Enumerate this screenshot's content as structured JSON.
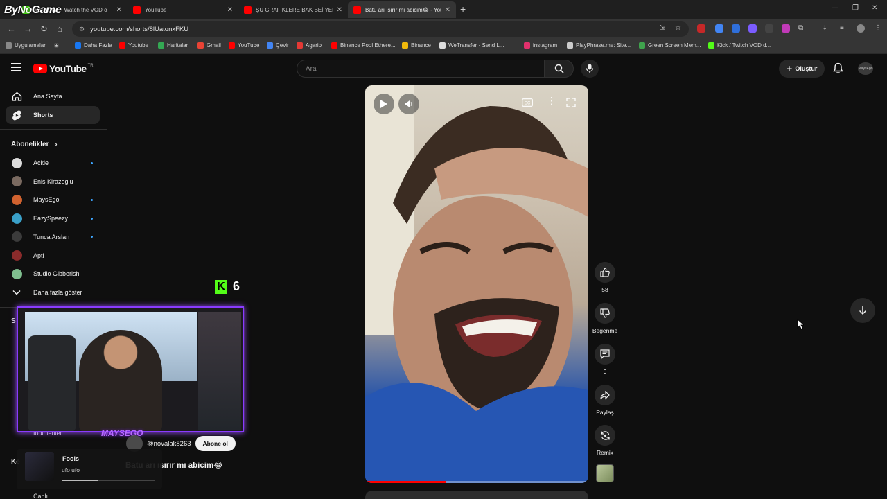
{
  "browser": {
    "overlay_brand": "ByNoGame",
    "tabs": [
      {
        "title": "MaysGo... - Watch the VOD o",
        "color": "#53fc18",
        "active": false
      },
      {
        "title": "YouTube",
        "color": "#ff0000",
        "active": false
      },
      {
        "title": "ŞU GRAFİKLERE BAK BEİ YEPYE",
        "color": "#ff0000",
        "active": false
      },
      {
        "title": "Batu arı ısırır mı abicim😂 - You",
        "color": "#ff0000",
        "active": true
      }
    ],
    "url": "youtube.com/shorts/8lUatonxFKU",
    "bookmarks": [
      {
        "label": "Uygulamalar",
        "color": "#888888"
      },
      {
        "label": "Daha Fazla",
        "color": "#1877f2"
      },
      {
        "label": "Youtube",
        "color": "#ff0000"
      },
      {
        "label": "Haritalar",
        "color": "#34a853"
      },
      {
        "label": "Gmail",
        "color": "#ea4335"
      },
      {
        "label": "YouTube",
        "color": "#ff0000"
      },
      {
        "label": "Çevir",
        "color": "#4285f4"
      },
      {
        "label": "Agario",
        "color": "#e53935"
      },
      {
        "label": "Binance Pool Ethere...",
        "color": "#ff0000"
      },
      {
        "label": "Binance",
        "color": "#f0b90b"
      },
      {
        "label": "WeTransfer - Send L...",
        "color": "#dddddd"
      },
      {
        "label": "instagram",
        "color": "#e1306c"
      },
      {
        "label": "PlayPhrase.me: Site...",
        "color": "#cccccc"
      },
      {
        "label": "Green Screen Mem...",
        "color": "#3fa34d"
      },
      {
        "label": "Kick / Twitch VOD d...",
        "color": "#53fc18"
      }
    ]
  },
  "masthead": {
    "logo_text": "YouTube",
    "region": "TR",
    "search_placeholder": "Ara",
    "create_label": "Oluştur",
    "avatar_text": "MaysEgo"
  },
  "sidebar": {
    "items": [
      {
        "label": "Ana Sayfa",
        "icon": "home-icon"
      },
      {
        "label": "Shorts",
        "icon": "shorts-icon",
        "active": true
      }
    ],
    "subscriptions_heading": "Abonelikler",
    "subscriptions": [
      {
        "label": "Ackie",
        "color": "#dcdcdc",
        "new": true
      },
      {
        "label": "Enis Kirazoglu",
        "color": "#7a6a60",
        "new": false
      },
      {
        "label": "MaysEgo",
        "color": "#d1622f",
        "new": true
      },
      {
        "label": "EazySpeezy",
        "color": "#3aa0c8",
        "new": true
      },
      {
        "label": "Tunca Arslan",
        "color": "#3b3b3b",
        "new": true
      },
      {
        "label": "Apti",
        "color": "#8a2b2b",
        "new": false
      },
      {
        "label": "Studio Gibberish",
        "color": "#7fbf8f",
        "new": false
      }
    ],
    "show_more": "Daha fazla göster",
    "hidden_labels": {
      "s": "S",
      "k": "Ke",
      "indirilenler": "İndirilenler",
      "canli": "Canlı"
    }
  },
  "short": {
    "progress": 0.36,
    "likes": "58",
    "dislike_label": "Beğenme",
    "comments": "0",
    "share_label": "Paylaş",
    "remix_label": "Remix",
    "channel": "@novalak8263",
    "subscribe_label": "Abone ol",
    "title": "Batu arı ısırır mı abicim😂"
  },
  "stream": {
    "kick_count": "6",
    "streamer_name": "MAYSEGO",
    "music_title": "Fools",
    "music_artist": "ufo ufo",
    "music_progress": 0.38
  }
}
